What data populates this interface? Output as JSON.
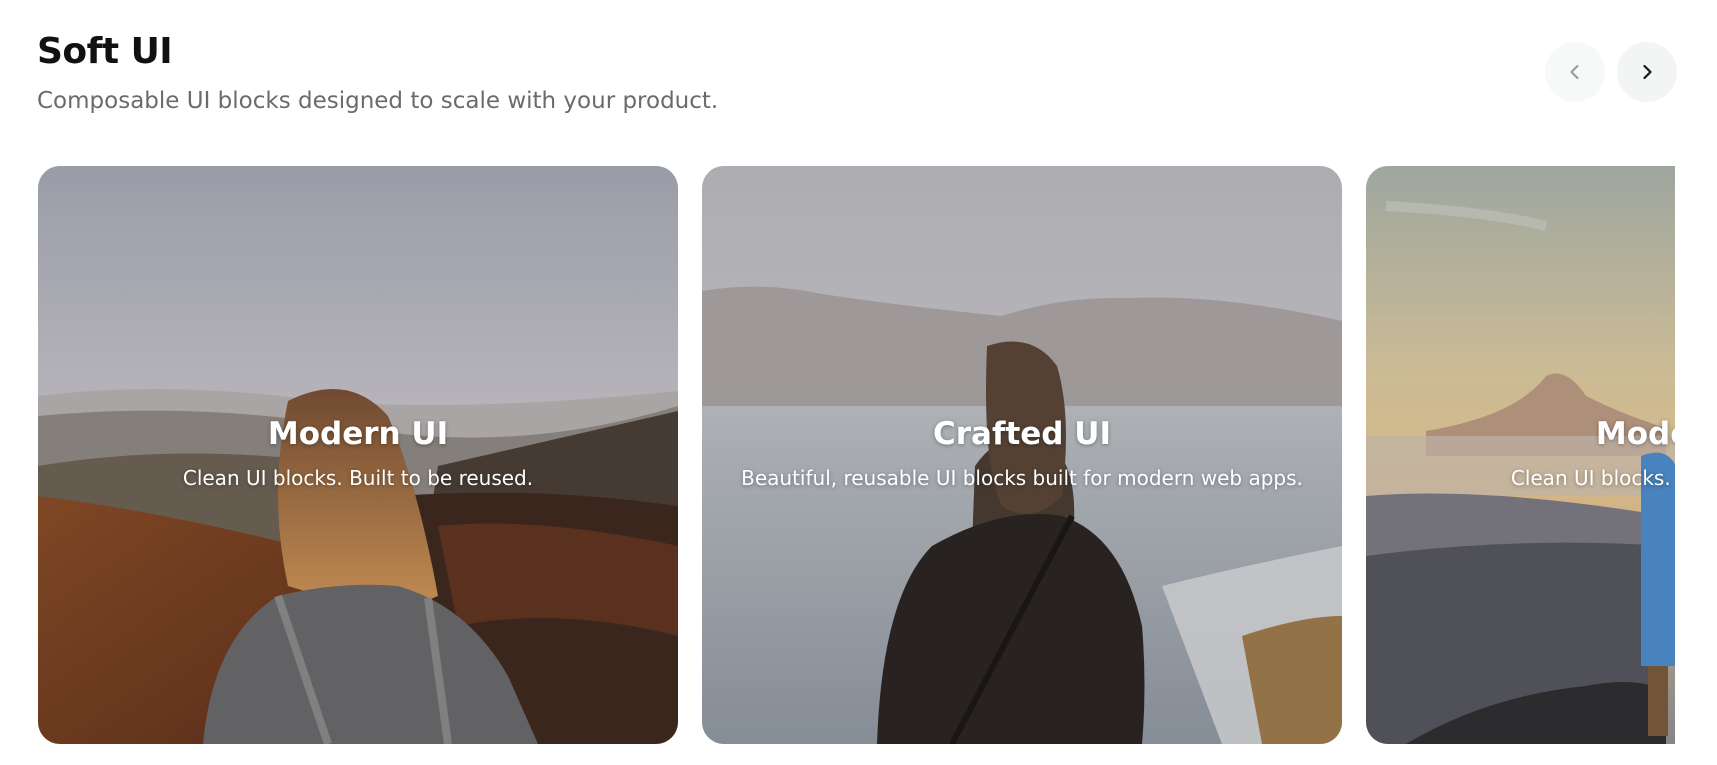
{
  "header": {
    "title": "Soft UI",
    "subtitle": "Composable UI blocks designed to scale with your product."
  },
  "nav": {
    "prev_icon": "chevron-left-icon",
    "next_icon": "chevron-right-icon"
  },
  "cards": [
    {
      "title": "Modern UI",
      "description": "Clean UI blocks. Built to be reused."
    },
    {
      "title": "Crafted UI",
      "description": "Beautiful, reusable UI blocks built for modern web apps."
    },
    {
      "title": "Modern UI",
      "description": "Clean UI blocks. Built to be reused."
    }
  ],
  "colors": {
    "title": "#111111",
    "subtitle": "#6b6b6b",
    "nav_button_bg": "#f3f4f4"
  }
}
